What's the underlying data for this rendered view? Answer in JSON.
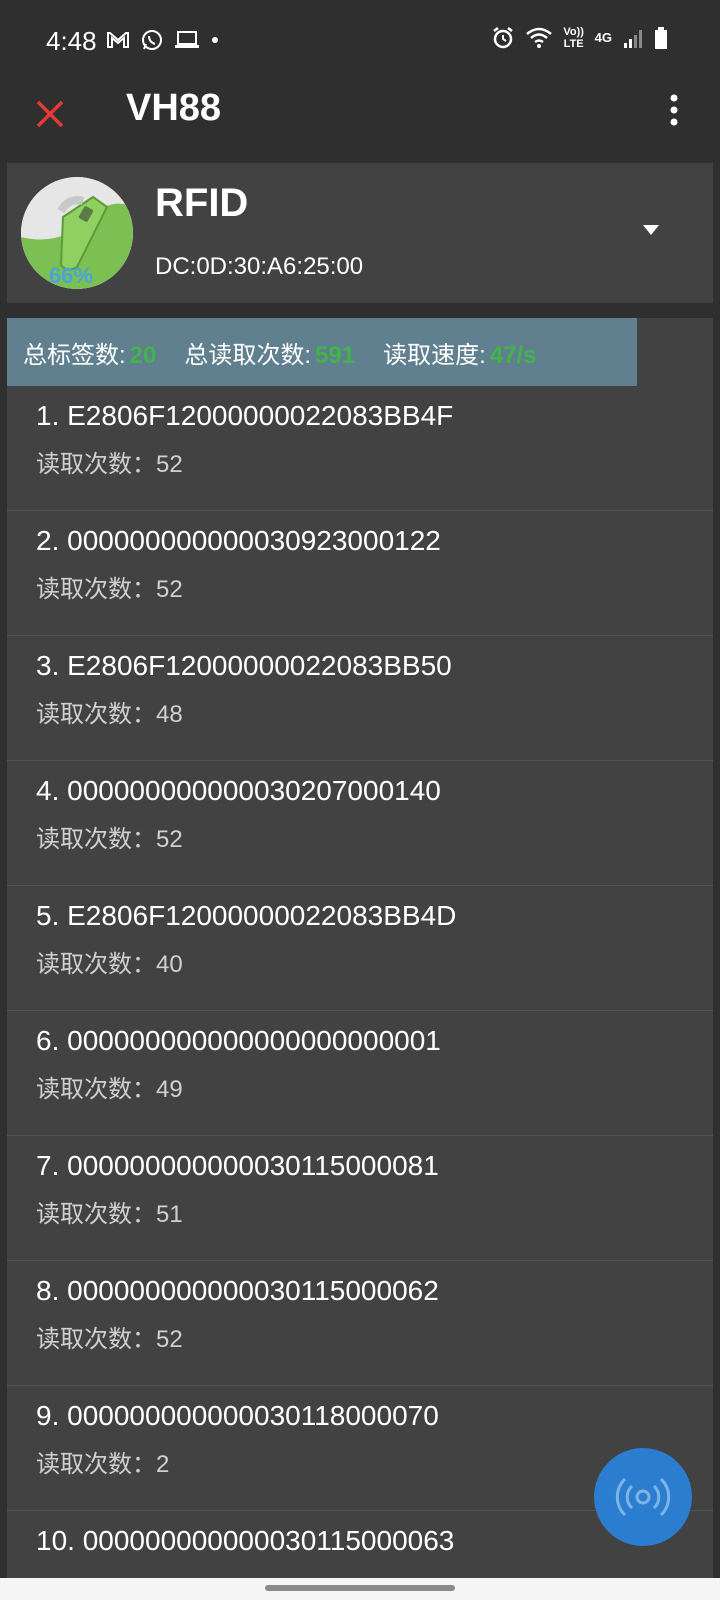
{
  "status_bar": {
    "time": "4:48",
    "left_icons": [
      "gmail-icon",
      "whatsapp-icon",
      "laptop-icon",
      "dot-icon"
    ],
    "right_icons": [
      "alarm-icon",
      "wifi-icon",
      "volte-icon",
      "4g-icon",
      "signal-icon",
      "battery-icon"
    ],
    "volte_label": "Vo)) LTE",
    "network_label": "4G"
  },
  "appbar": {
    "title": "VH88"
  },
  "device": {
    "name": "RFID",
    "mac": "DC:0D:30:A6:25:00",
    "battery": "66%"
  },
  "stats": {
    "total_tags_label": "总标签数:",
    "total_tags_value": "20",
    "total_reads_label": "总读取次数:",
    "total_reads_value": "591",
    "speed_label": "读取速度:",
    "speed_value": "47/s"
  },
  "tags": [
    {
      "id": "1. E2806F12000000022083BB4F",
      "count": "读取次数：52"
    },
    {
      "id": "2. 000000000000030923000122",
      "count": "读取次数：52"
    },
    {
      "id": "3. E2806F12000000022083BB50",
      "count": "读取次数：48"
    },
    {
      "id": "4. 000000000000030207000140",
      "count": "读取次数：52"
    },
    {
      "id": "5. E2806F12000000022083BB4D",
      "count": "读取次数：40"
    },
    {
      "id": "6. 000000000000000000000001",
      "count": "读取次数：49"
    },
    {
      "id": "7. 000000000000030115000081",
      "count": "读取次数：51"
    },
    {
      "id": "8. 000000000000030115000062",
      "count": "读取次数：52"
    },
    {
      "id": "9. 000000000000030118000070",
      "count": "读取次数：2"
    },
    {
      "id": "10. 000000000000030115000063",
      "count": ""
    }
  ],
  "colors": {
    "background": "#2f2f2f",
    "card": "#424242",
    "stats_bar": "#60808f",
    "accent_green": "#43b34b",
    "close_red": "#e53935",
    "fab_blue": "#2b7dd0"
  }
}
